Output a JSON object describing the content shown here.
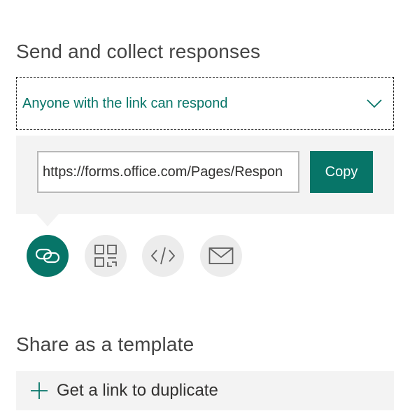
{
  "send": {
    "title": "Send and collect responses",
    "audience_selected": "Anyone with the link can respond",
    "link_url": "https://forms.office.com/Pages/Respon",
    "copy_label": "Copy",
    "share_methods": [
      {
        "icon": "link-icon",
        "active": true
      },
      {
        "icon": "qr-code-icon",
        "active": false
      },
      {
        "icon": "embed-code-icon",
        "active": false
      },
      {
        "icon": "email-icon",
        "active": false
      }
    ]
  },
  "template": {
    "title": "Share as a template",
    "duplicate_label": "Get a link to duplicate"
  },
  "colors": {
    "accent": "#077568",
    "panel_bg": "#f3f3f3",
    "icon_bg": "#ececec"
  }
}
